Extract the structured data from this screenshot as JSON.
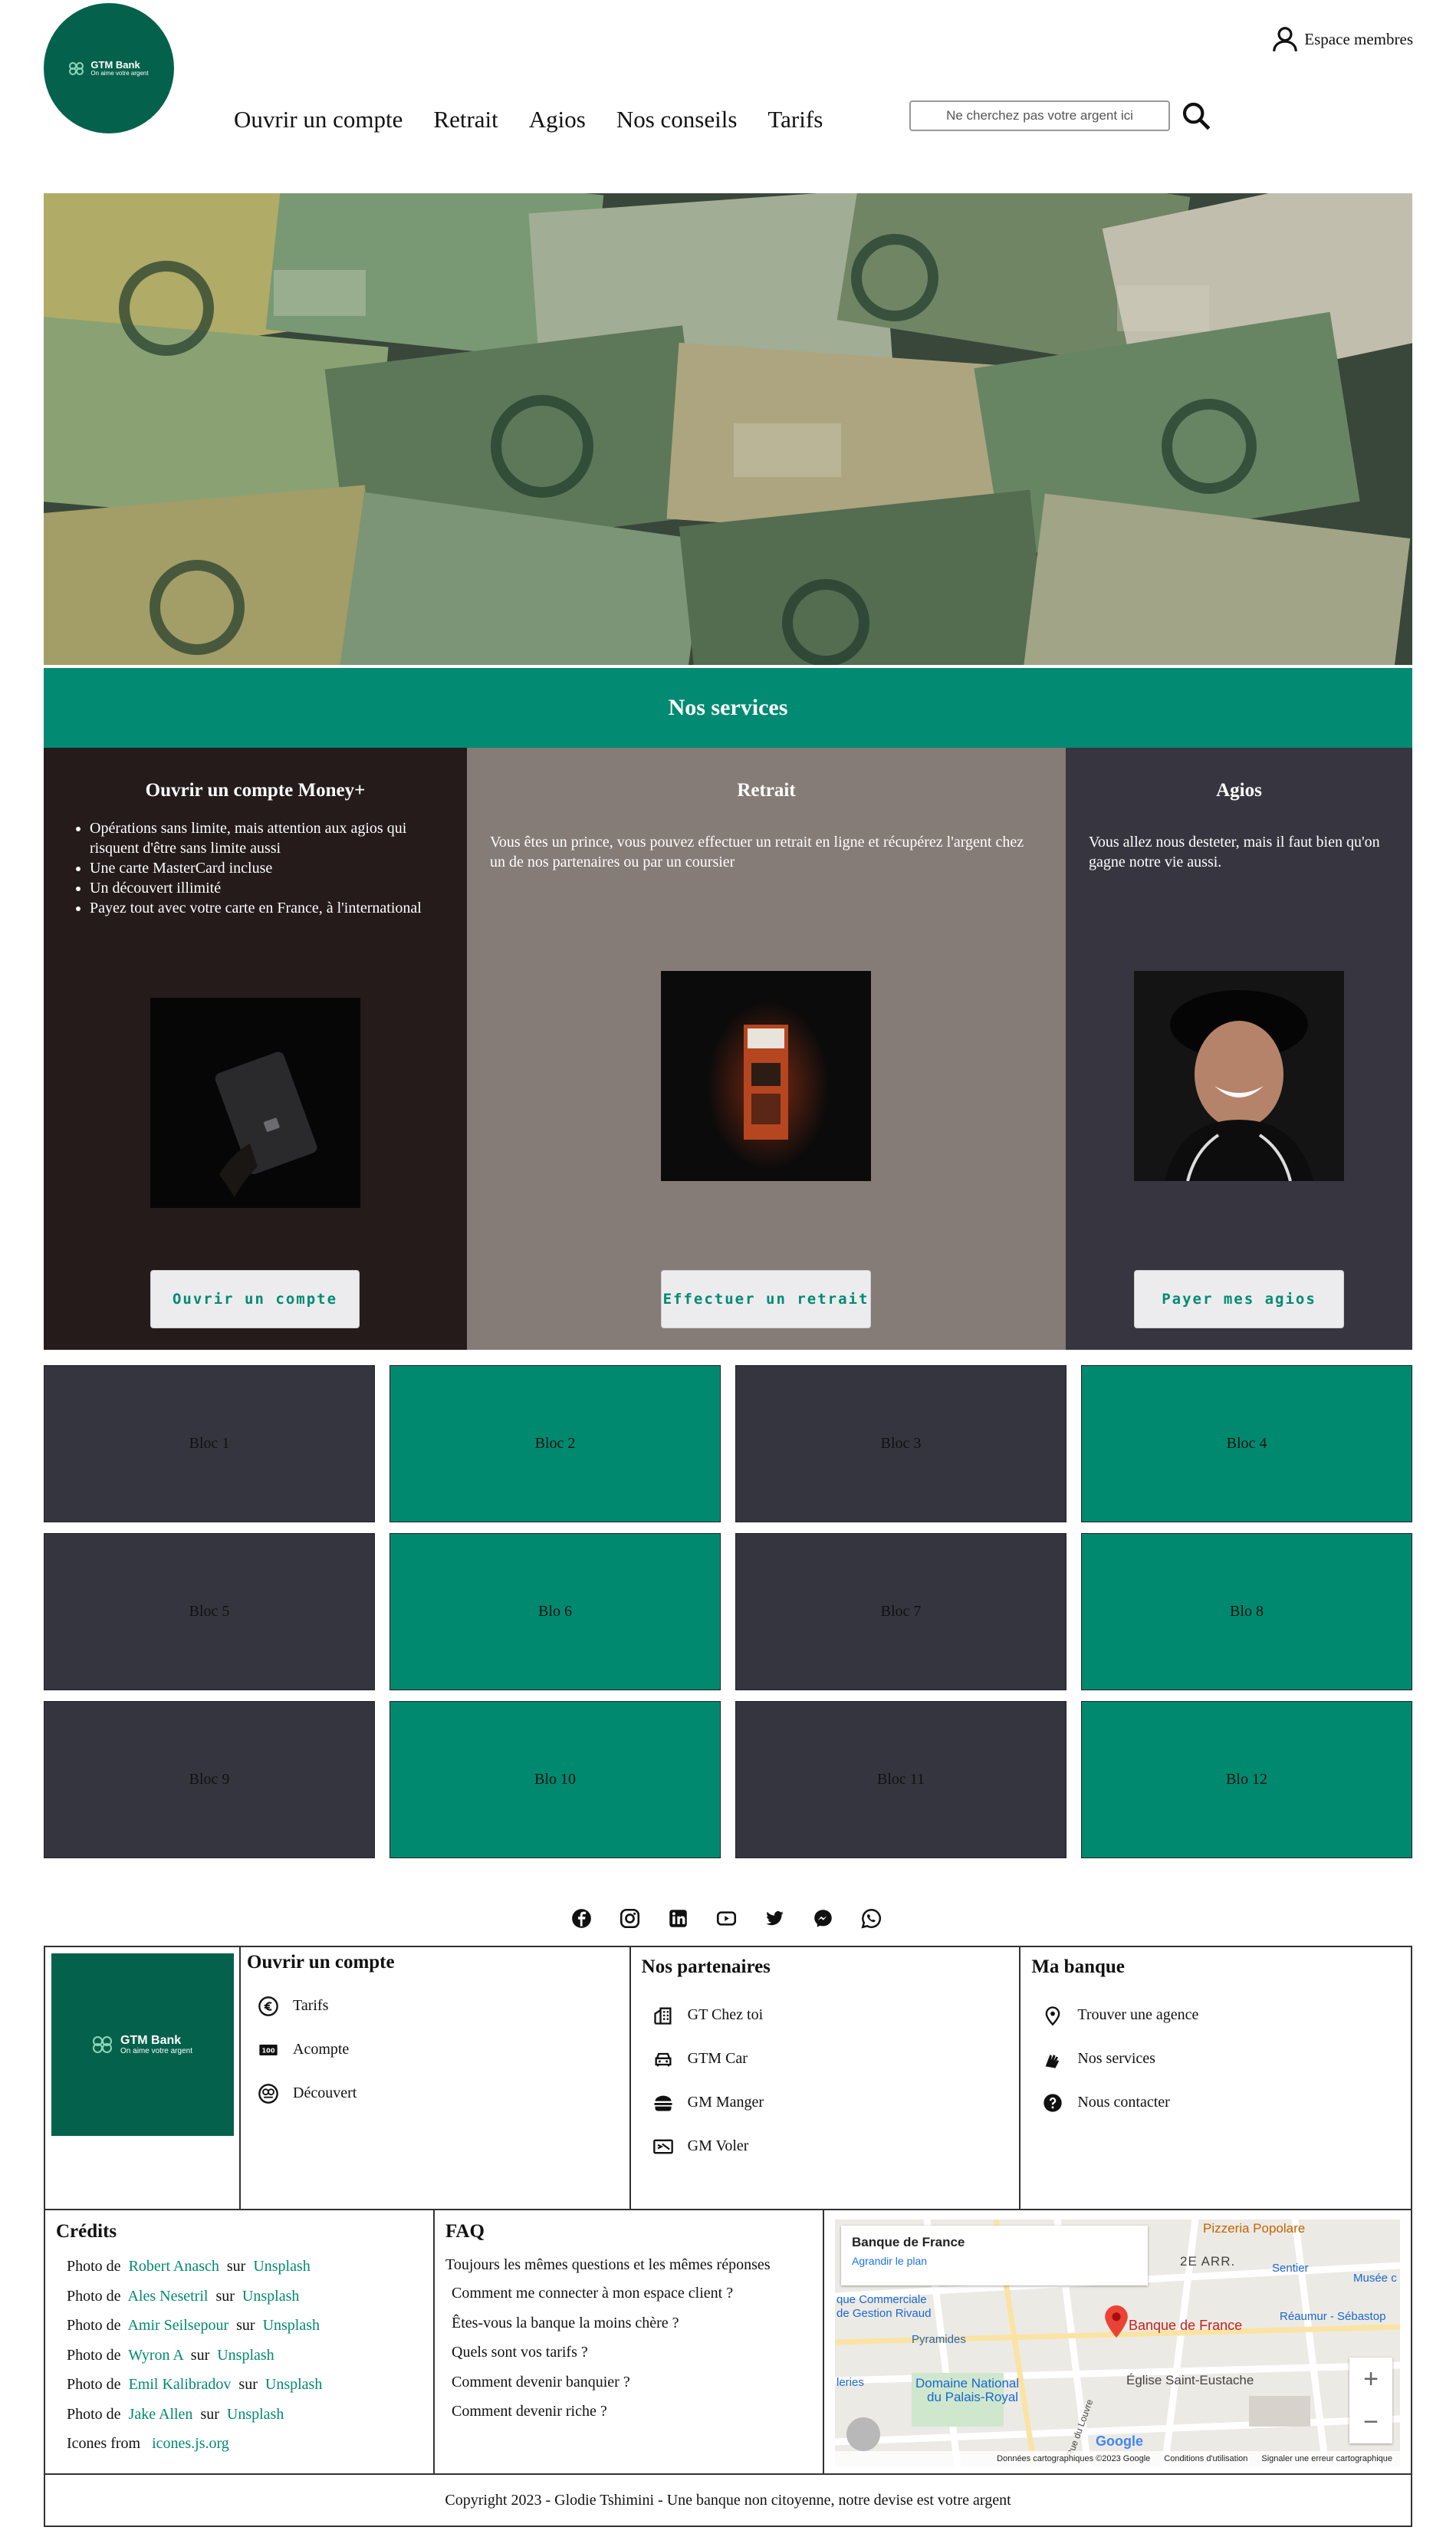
{
  "brand": {
    "name": "GTM Bank",
    "tagline": "On aime votre argent",
    "color": "#04614c",
    "accent": "#028a72"
  },
  "header": {
    "member_label": "Espace membres",
    "nav": [
      "Ouvrir un compte",
      "Retrait",
      "Agios",
      "Nos conseils",
      "Tarifs"
    ],
    "search_placeholder": "Ne cherchez pas votre argent ici"
  },
  "services": {
    "title": "Nos services",
    "cards": [
      {
        "title": "Ouvrir un compte Money+",
        "items": [
          "Opérations sans limite, mais attention aux agios qui risquent d'être sans limite aussi",
          "Une carte MasterCard incluse",
          "Un découvert illimité",
          "Payez tout avec votre carte en France, à l'international"
        ],
        "button": "Ouvrir un compte"
      },
      {
        "title": "Retrait",
        "text": "Vous êtes un prince, vous pouvez effectuer un retrait en ligne et récupérez l'argent chez un de nos partenaires ou par un coursier",
        "button": "Effectuer un retrait"
      },
      {
        "title": "Agios",
        "text": "Vous allez nous desteter, mais il faut bien qu'on gagne notre vie aussi.",
        "button": "Payer mes agios"
      }
    ]
  },
  "blocs": [
    "Bloc 1",
    "Bloc 2",
    "Bloc 3",
    "Bloc 4",
    "Bloc 5",
    "Blo 6",
    "Bloc 7",
    "Blo 8",
    "Bloc 9",
    "Blo 10",
    "Bloc 11",
    "Blo 12"
  ],
  "social": [
    "facebook-icon",
    "instagram-icon",
    "linkedin-icon",
    "youtube-icon",
    "twitter-icon",
    "messenger-icon",
    "whatsapp-icon"
  ],
  "footer": {
    "col_account": {
      "title": "Ouvrir un compte",
      "items": [
        "Tarifs",
        "Acompte",
        "Découvert"
      ]
    },
    "col_partners": {
      "title": "Nos partenaires",
      "items": [
        "GT Chez toi",
        "GTM Car",
        "GM Manger",
        "GM Voler"
      ]
    },
    "col_bank": {
      "title": "Ma banque",
      "items": [
        "Trouver une agence",
        "Nos services",
        "Nous contacter"
      ]
    },
    "credits": {
      "title": "Crédits",
      "prefix": "Photo de",
      "sep": "sur",
      "rows": [
        {
          "author": "Robert Anasch",
          "site": "Unsplash"
        },
        {
          "author": "Ales Nesetril",
          "site": "Unsplash"
        },
        {
          "author": "Amir Seilsepour",
          "site": "Unsplash"
        },
        {
          "author": "Wyron A",
          "site": "Unsplash"
        },
        {
          "author": "Emil Kalibradov",
          "site": "Unsplash"
        },
        {
          "author": "Jake Allen",
          "site": "Unsplash"
        }
      ],
      "icons_label": "Icones from",
      "icons_site": "icones.js.org"
    },
    "faq": {
      "title": "FAQ",
      "intro": "Toujours les mêmes questions et les mêmes réponses",
      "items": [
        "Comment me connecter à mon espace client ?",
        "Êtes-vous la banque la moins chère ?",
        "Quels sont vos tarifs ?",
        "Comment devenir banquier ?",
        "Comment devenir riche ?"
      ]
    },
    "map": {
      "place": "Banque de France",
      "link": "Agrandir le plan",
      "labels": [
        "2E ARR.",
        "Pizzeria Popolare",
        "Sentier",
        "Musée c",
        "que Commerciale",
        "de Gestion Rivaud",
        "Pyramides",
        "Réaumur - Sébastop",
        "Domaine National",
        "du Palais-Royal",
        "Église Saint-Eustache",
        "leries",
        "Rue du Louvre"
      ],
      "attribution": [
        "Données cartographiques ©2023 Google",
        "Conditions d'utilisation",
        "Signaler une erreur cartographique"
      ],
      "logo": "Google"
    },
    "copyright": "Copyright 2023 - Glodie Tshimini - Une banque non citoyenne, notre devise est votre argent"
  }
}
